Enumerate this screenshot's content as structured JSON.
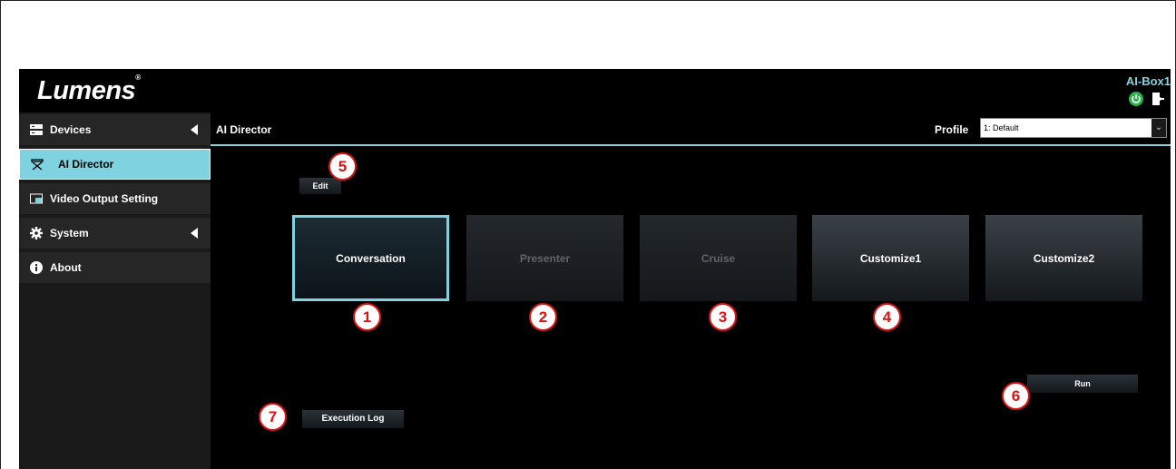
{
  "header": {
    "logo": "Lumens",
    "logo_mark": "®",
    "device_name": "AI-Box1",
    "power_icon": "power-icon",
    "logout_icon": "logout-icon",
    "accent_color": "#7fd3e0"
  },
  "sidebar": {
    "items": [
      {
        "label": "Devices",
        "icon": "devices-icon",
        "expandable": true
      },
      {
        "label": "AI Director",
        "icon": "director-icon",
        "active": true
      },
      {
        "label": "Video Output Setting",
        "icon": "video-output-icon"
      },
      {
        "label": "System",
        "icon": "gear-icon",
        "expandable": true
      },
      {
        "label": "About",
        "icon": "info-icon"
      }
    ]
  },
  "main": {
    "title": "AI Director",
    "profile_label": "Profile",
    "profile_value": "1: Default",
    "edit_label": "Edit",
    "run_label": "Run",
    "log_label": "Execution Log",
    "modes": [
      {
        "label": "Conversation",
        "state": "selected"
      },
      {
        "label": "Presenter",
        "state": "disabled"
      },
      {
        "label": "Cruise",
        "state": "disabled"
      },
      {
        "label": "Customize1",
        "state": "normal"
      },
      {
        "label": "Customize2",
        "state": "normal"
      }
    ]
  },
  "callouts": [
    "1",
    "2",
    "3",
    "4",
    "5",
    "6",
    "7"
  ]
}
